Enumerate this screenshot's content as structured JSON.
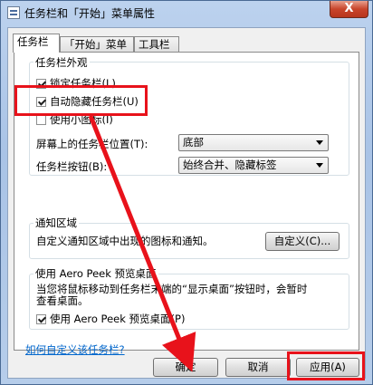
{
  "window": {
    "title": "任务栏和「开始」菜单属性",
    "close_label": "X"
  },
  "tabs": [
    {
      "label": "任务栏"
    },
    {
      "label": "「开始」菜单"
    },
    {
      "label": "工具栏"
    }
  ],
  "appearance": {
    "title": "任务栏外观",
    "lock_label": "锁定任务栏(L)",
    "lock_checked": true,
    "autohide_label": "自动隐藏任务栏(U)",
    "autohide_checked": true,
    "small_icons_label": "使用小图标(I)",
    "small_icons_checked": false,
    "position_label": "屏幕上的任务栏位置(T):",
    "position_value": "底部",
    "buttons_label": "任务栏按钮(B):",
    "buttons_value": "始终合并、隐藏标签"
  },
  "notify": {
    "title": "通知区域",
    "desc": "自定义通知区域中出现的图标和通知。",
    "customize_label": "自定义(C)..."
  },
  "aero": {
    "title": "使用 Aero Peek 预览桌面",
    "desc_line1": "当您将鼠标移动到任务栏末端的“显示桌面”按钮时，会暂时",
    "desc_line2": "查看桌面。",
    "check_label": "使用 Aero Peek 预览桌面(P)",
    "check_checked": true
  },
  "help_link": "如何自定义该任务栏?",
  "footer": {
    "ok_label": "确定",
    "cancel_label": "取消",
    "apply_label": "应用(A)"
  },
  "colors": {
    "highlight": "#e8121b",
    "link": "#0066cc"
  }
}
